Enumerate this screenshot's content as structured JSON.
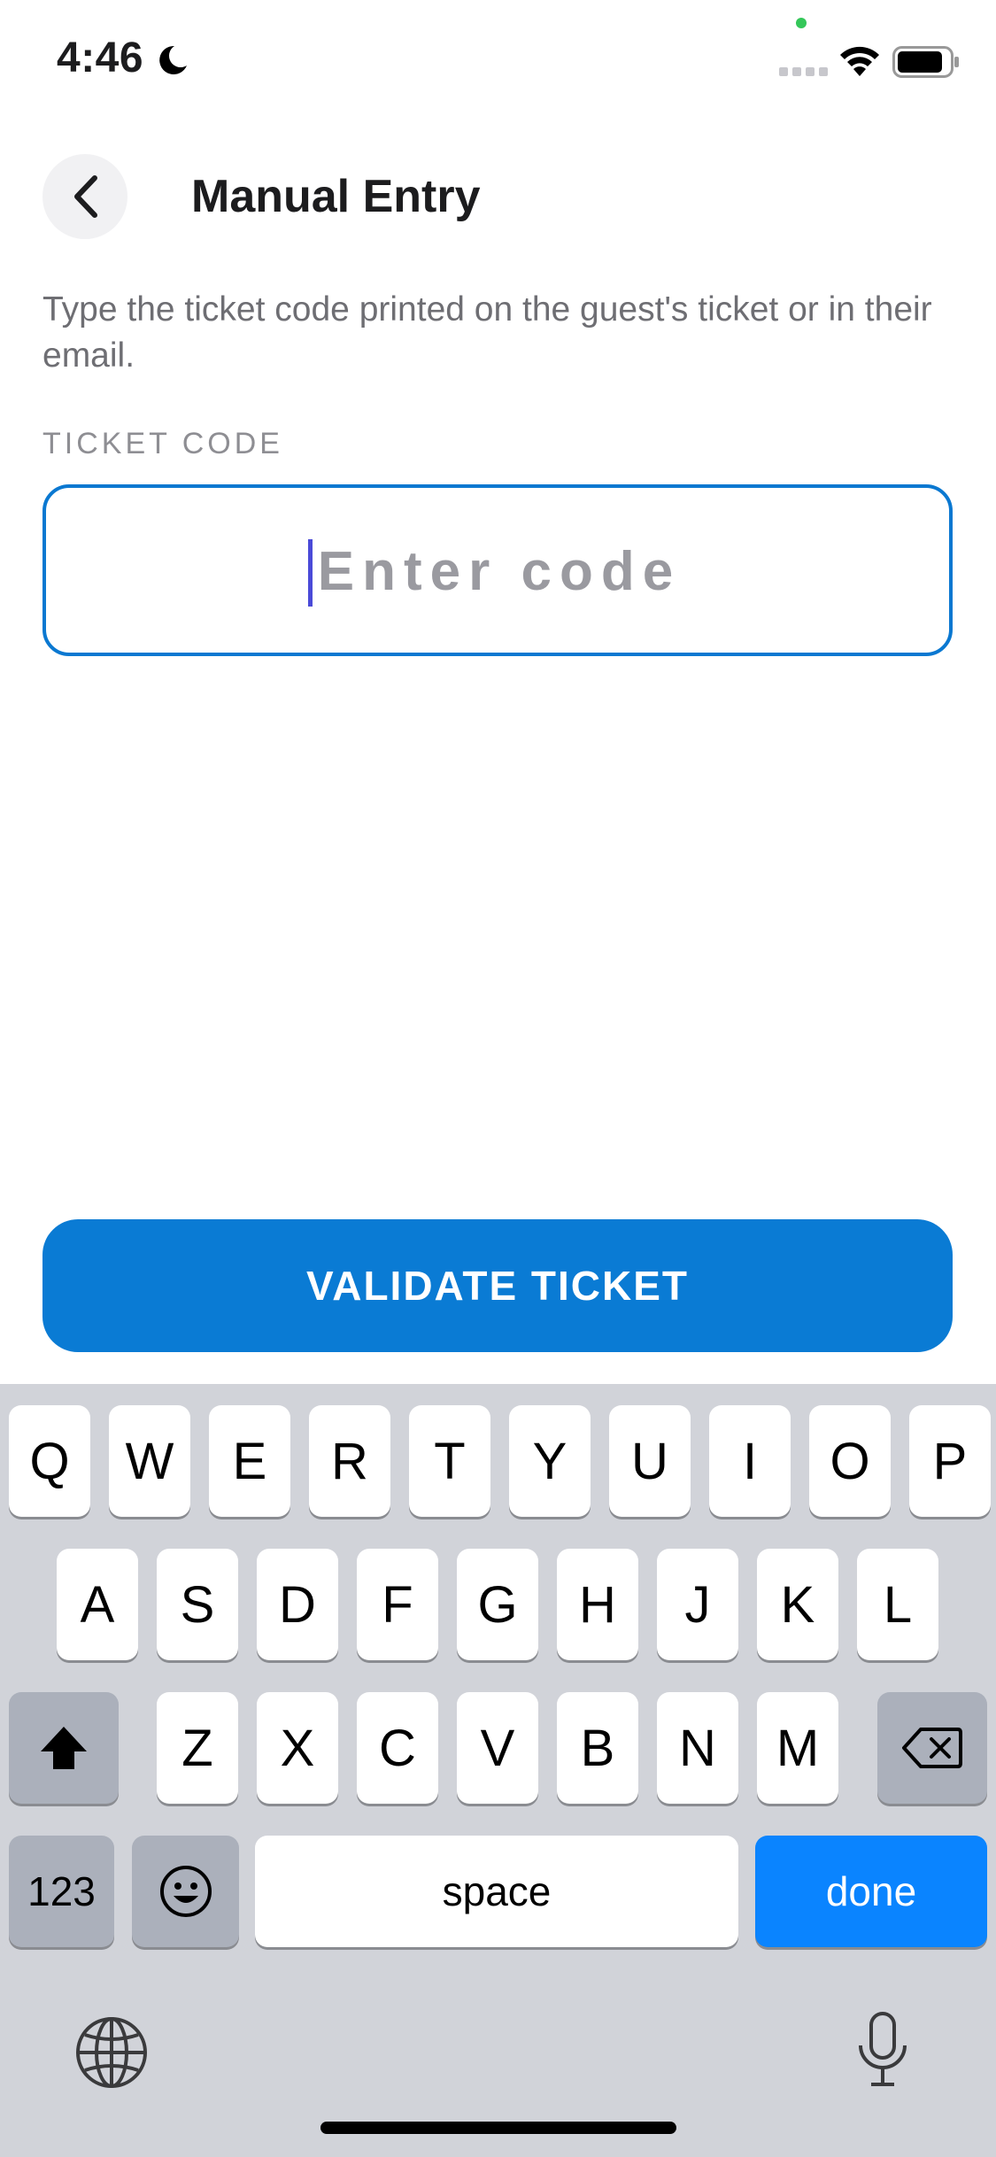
{
  "status_bar": {
    "time": "4:46"
  },
  "header": {
    "title": "Manual Entry"
  },
  "description": "Type the ticket code printed on the guest's ticket or in their email.",
  "field": {
    "label": "TICKET CODE",
    "placeholder": "Enter code",
    "value": ""
  },
  "validate_button": {
    "label": "VALIDATE TICKET"
  },
  "keyboard": {
    "row1": [
      "Q",
      "W",
      "E",
      "R",
      "T",
      "Y",
      "U",
      "I",
      "O",
      "P"
    ],
    "row2": [
      "A",
      "S",
      "D",
      "F",
      "G",
      "H",
      "J",
      "K",
      "L"
    ],
    "row3": [
      "Z",
      "X",
      "C",
      "V",
      "B",
      "N",
      "M"
    ],
    "numbers_key": "123",
    "space_key": "space",
    "done_key": "done"
  },
  "colors": {
    "accent": "#0a7bd4",
    "done_key": "#0a84ff",
    "keyboard_bg": "#d1d3d9"
  }
}
